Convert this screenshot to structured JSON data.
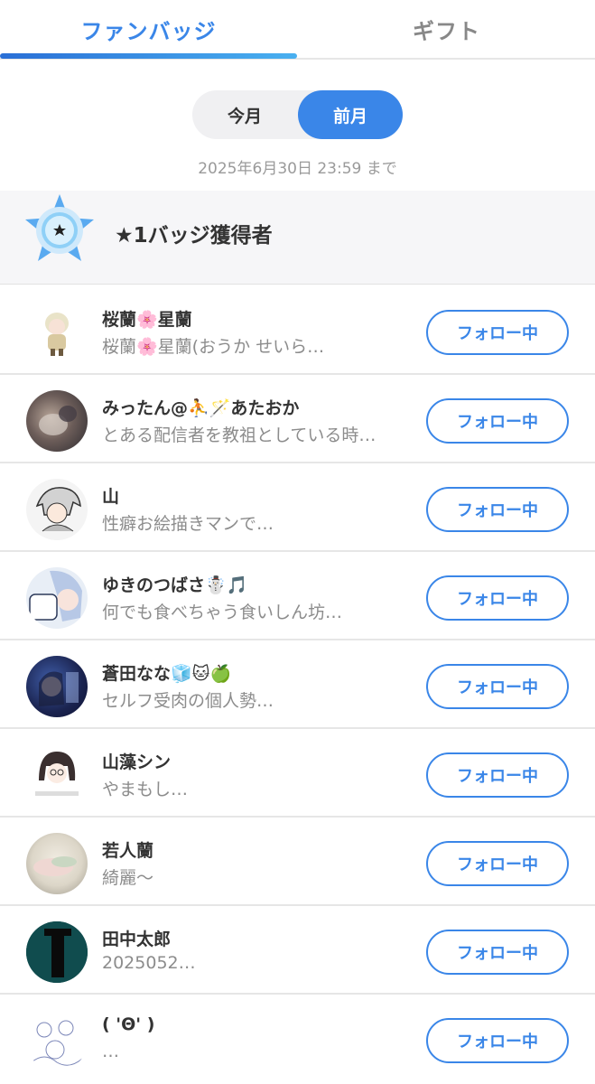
{
  "tabs": {
    "fan_badge": "ファンバッジ",
    "gift": "ギフト"
  },
  "segment": {
    "this_month": "今月",
    "last_month": "前月"
  },
  "period_text": "2025年6月30日 23:59 まで",
  "rank_header": {
    "title": "★1バッジ獲得者"
  },
  "follow_label": "フォロー中",
  "users": [
    {
      "name": "桜蘭🌸星蘭",
      "desc": "桜蘭🌸星蘭(おうか せいら…",
      "follow": "フォロー中"
    },
    {
      "name": "みったん@⛹️🪄あたおか",
      "desc": "とある配信者を教祖としている時…",
      "follow": "フォロー中"
    },
    {
      "name": "山",
      "desc": "性癖お絵描きマンで…",
      "follow": "フォロー中"
    },
    {
      "name": "ゆきのつばさ☃️🎵",
      "desc": "何でも食べちゃう食いしん坊…",
      "follow": "フォロー中"
    },
    {
      "name": "蒼田なな🧊🐱🍏",
      "desc": "セルフ受肉の個人勢…",
      "follow": "フォロー中"
    },
    {
      "name": "山藻シン",
      "desc": "やまもし…",
      "follow": "フォロー中"
    },
    {
      "name": "若人蘭",
      "desc": "綺麗〜",
      "follow": "フォロー中"
    },
    {
      "name": "田中太郎",
      "desc": "2025052…",
      "follow": "フォロー中"
    },
    {
      "name": "( 'Θ' )",
      "desc": "…",
      "follow": "フォロー中"
    }
  ]
}
